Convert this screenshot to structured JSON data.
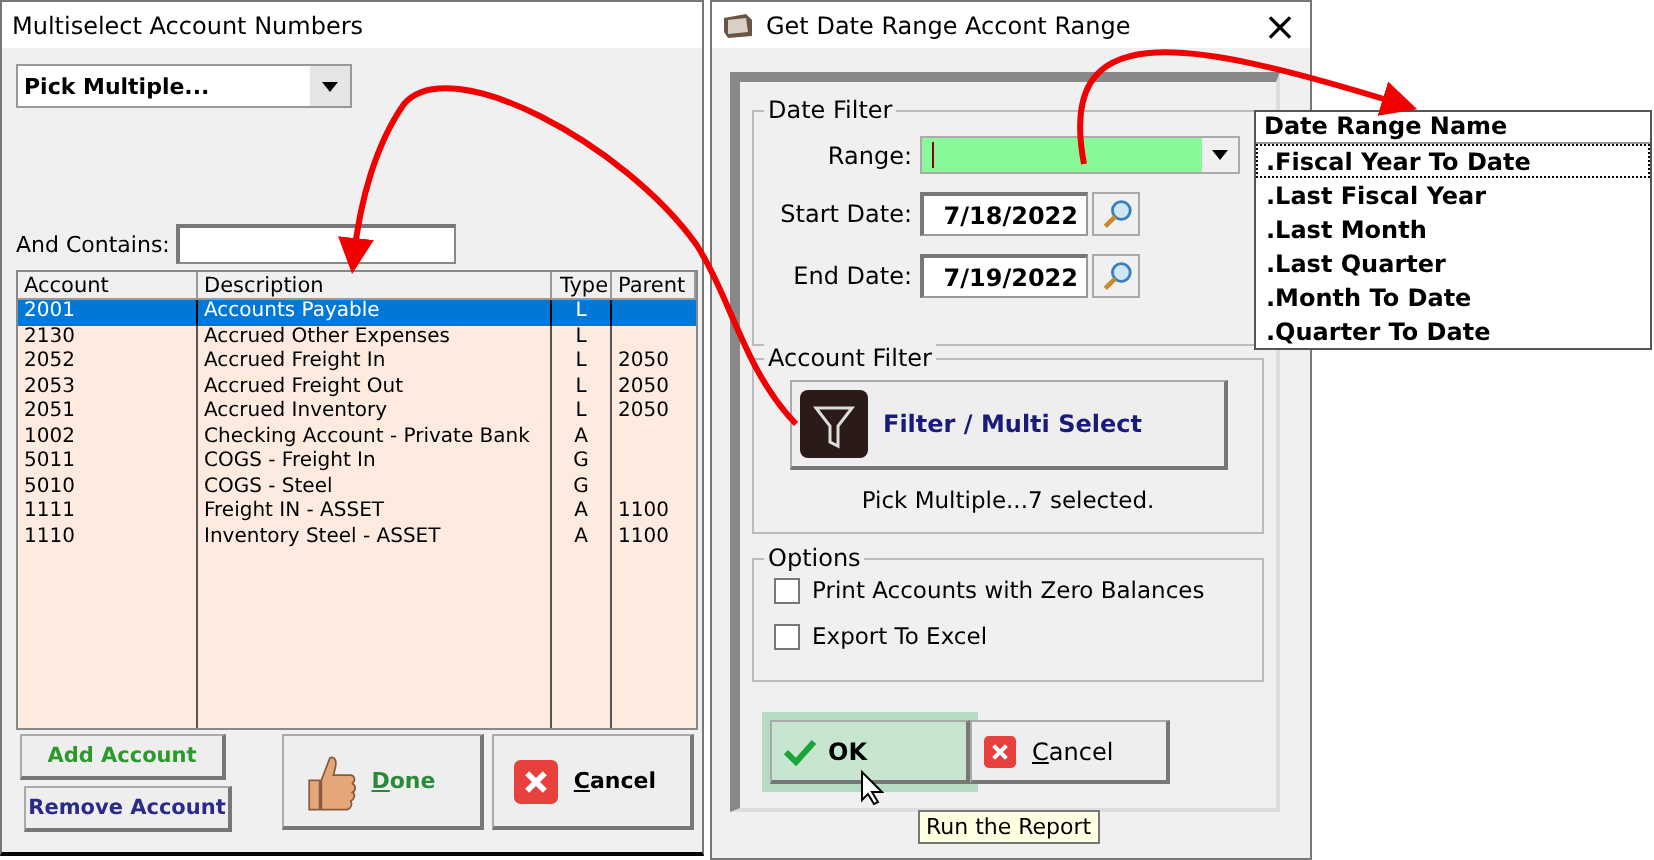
{
  "left_window": {
    "title": "Multiselect Account Numbers",
    "picker": {
      "value": "Pick Multiple..."
    },
    "contains": {
      "label": "And Contains:"
    },
    "table": {
      "columns": [
        "Account",
        "Description",
        "Type",
        "Parent"
      ],
      "rows": [
        {
          "cells": [
            "2001",
            "Accounts Payable",
            "L",
            ""
          ],
          "selected": true
        },
        {
          "cells": [
            "2130",
            "Accrued  Other Expenses",
            "L",
            ""
          ],
          "selected": false
        },
        {
          "cells": [
            "2052",
            "Accrued Freight In",
            "L",
            "2050"
          ],
          "selected": false
        },
        {
          "cells": [
            "2053",
            "Accrued Freight Out",
            "L",
            "2050"
          ],
          "selected": false
        },
        {
          "cells": [
            "2051",
            "Accrued Inventory",
            "L",
            "2050"
          ],
          "selected": false
        },
        {
          "cells": [
            "1002",
            "Checking Account - Private Bank",
            "A",
            ""
          ],
          "selected": false
        },
        {
          "cells": [
            "5011",
            "COGS - Freight In",
            "G",
            ""
          ],
          "selected": false
        },
        {
          "cells": [
            "5010",
            "COGS - Steel",
            "G",
            ""
          ],
          "selected": false
        },
        {
          "cells": [
            "1111",
            "Freight IN - ASSET",
            "A",
            "1100"
          ],
          "selected": false
        },
        {
          "cells": [
            "1110",
            "Inventory Steel - ASSET",
            "A",
            "1100"
          ],
          "selected": false
        }
      ]
    },
    "buttons": [
      {
        "label": "Add Account",
        "kind": "add"
      },
      {
        "label": "Remove Account",
        "kind": "remove"
      },
      {
        "label": "Done",
        "kind": "done"
      },
      {
        "label": "Cancel",
        "kind": "cancel"
      }
    ]
  },
  "right_window": {
    "title": "Get Date Range Accont Range",
    "close": "×",
    "date_filter": {
      "title": "Date Filter",
      "range_label": "Range:",
      "start_label": "Start Date:",
      "start": "7/18/2022",
      "end_label": "End Date:",
      "end": "7/19/2022"
    },
    "account_filter": {
      "title": "Account Filter",
      "button": "Filter / Multi Select",
      "summary": "Pick Multiple...7 selected."
    },
    "options": {
      "title": "Options",
      "items": [
        {
          "label": "Print Accounts with Zero Balances",
          "checked": false
        },
        {
          "label": "Export To Excel",
          "checked": false
        }
      ]
    },
    "buttons": [
      {
        "label": "OK",
        "kind": "ok",
        "hovered": true
      },
      {
        "label": "Cancel",
        "kind": "cancel",
        "hovered": false
      }
    ],
    "tooltip": "Run the Report"
  },
  "range_dropdown": {
    "header": "Date Range Name",
    "items": [
      {
        "label": ".Fiscal Year To Date",
        "selected": true
      },
      {
        "label": ".Last Fiscal Year",
        "selected": false
      },
      {
        "label": ".Last Month",
        "selected": false
      },
      {
        "label": ".Last Quarter",
        "selected": false
      },
      {
        "label": ".Month To Date",
        "selected": false
      },
      {
        "label": ".Quarter To Date",
        "selected": false
      }
    ]
  }
}
